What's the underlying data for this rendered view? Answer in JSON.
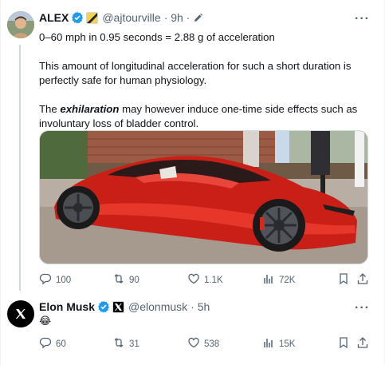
{
  "colors": {
    "text": "#0f1419",
    "muted": "#536471",
    "verified": "#1d9bf0",
    "border": "#cfd9de"
  },
  "tweet1": {
    "name": "ALEX",
    "handle": "@ajtourville",
    "time": "· 9h ·",
    "line1": "0–60 mph in 0.95 seconds = 2.88 g of acceleration",
    "para2": "This amount of longitudinal acceleration for such a short duration is perfectly safe for human physiology.",
    "para3_pre": "The ",
    "para3_em": "exhilaration",
    "para3_post": " may however induce one-time side effects such as involuntary loss of bladder control.",
    "media_icon": "red-sports-car-photo",
    "replies": "100",
    "reposts": "90",
    "likes": "1.1K",
    "views": "72K"
  },
  "tweet2": {
    "name": "Elon Musk",
    "handle": "@elonmusk",
    "time": "· 5h",
    "emoji": "😂",
    "replies": "60",
    "reposts": "31",
    "likes": "538",
    "views": "15K"
  },
  "icons": {
    "reply": "reply-icon",
    "repost": "repost-icon",
    "like": "heart-icon",
    "views": "views-icon",
    "bookmark": "bookmark-icon",
    "share": "share-icon",
    "more": "more-icon",
    "edit": "edited-pencil-icon",
    "verified": "verified-badge-icon",
    "affiliate": "affiliate-badge-icon"
  }
}
